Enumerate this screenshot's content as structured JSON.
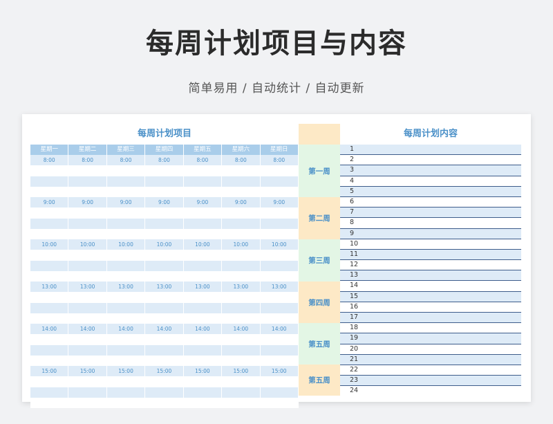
{
  "header": {
    "title": "每周计划项目与内容",
    "subtitle": "简单易用 / 自动统计 / 自动更新"
  },
  "sheet": {
    "left_title": "每周计划项目",
    "right_title": "每周计划内容",
    "days": [
      "星期一",
      "星期二",
      "星期三",
      "星期四",
      "星期五",
      "星期六",
      "星期日"
    ],
    "time_blocks": [
      "8:00",
      "9:00",
      "10:00",
      "13:00",
      "14:00",
      "15:00"
    ],
    "weeks": [
      "第一周",
      "第二周",
      "第三周",
      "第四周",
      "第五周",
      "第五周"
    ],
    "numbers": [
      "1",
      "2",
      "3",
      "4",
      "5",
      "6",
      "7",
      "8",
      "9",
      "10",
      "11",
      "12",
      "13",
      "14",
      "15",
      "16",
      "17",
      "18",
      "19",
      "20",
      "21",
      "22",
      "23",
      "24"
    ]
  },
  "colors": {
    "accent": "#4a90c8",
    "day_header": "#a9cdea",
    "row_blue": "#deebf7",
    "week_green": "#e3f6e5",
    "week_peach": "#fde9c6",
    "rule": "#3d5c8a"
  }
}
